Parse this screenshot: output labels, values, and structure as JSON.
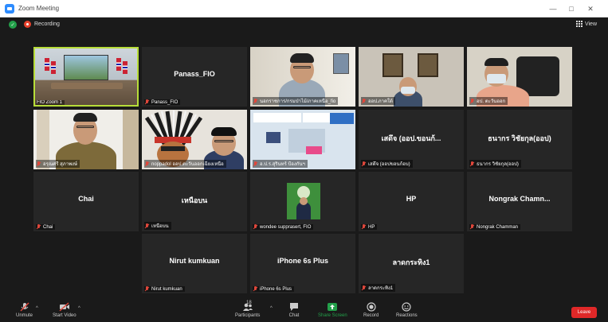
{
  "window": {
    "title": "Zoom Meeting"
  },
  "status": {
    "recording_label": "Recording",
    "view_label": "View"
  },
  "tiles": [
    {
      "id": "t1",
      "display_name": "",
      "label": "FIO Zoom 1",
      "video": true,
      "active": true
    },
    {
      "id": "t2",
      "display_name": "Panass_FIO",
      "label": "Panass_FIO",
      "video": false
    },
    {
      "id": "t3",
      "display_name": "",
      "label": "นอกราชการ/กรมป่าไม้/ภาคเหนือ_fio",
      "video": true
    },
    {
      "id": "t4",
      "display_name": "",
      "label": "ออป.ภาคใต้",
      "video": true
    },
    {
      "id": "t5",
      "display_name": "",
      "label": "อป. ตะวันออก",
      "video": true
    },
    {
      "id": "t6",
      "display_name": "",
      "label": "อรุณศรี สุภาพงษ์",
      "video": true
    },
    {
      "id": "t7",
      "display_name": "",
      "label": "noppadol ออป.ตะวันออกเฉียงเหนือ",
      "video": true
    },
    {
      "id": "t8",
      "display_name": "",
      "label": "อ.ป.ร.สุรินทร์ ป้องกันฯ",
      "video": true
    },
    {
      "id": "t9",
      "display_name": "เสดึจ (ออป.ขอนก้...",
      "label": "เสดึจ (ออปขอนก้อบ)",
      "video": false
    },
    {
      "id": "t10",
      "display_name": "ธนากร วิชัยกุล(ออป)",
      "label": "ธนากร วิชัยกุล(ออป)",
      "video": false
    },
    {
      "id": "t11",
      "display_name": "Chai",
      "label": "Chai",
      "video": false
    },
    {
      "id": "t12",
      "display_name": "เหนือบน",
      "label": "เหนือบน",
      "video": false
    },
    {
      "id": "t13",
      "display_name": "",
      "label": "wondee supprasert, FIO",
      "video": true
    },
    {
      "id": "t14",
      "display_name": "HP",
      "label": "HP",
      "video": false
    },
    {
      "id": "t15",
      "display_name": "Nongrak Chamn...",
      "label": "Nongrak Chamman",
      "video": false
    },
    {
      "id": "t16",
      "display_name": "Nirut kumkuan",
      "label": "Nirut kumkuan",
      "video": false
    },
    {
      "id": "t17",
      "display_name": "iPhone 6s Plus",
      "label": "iPhone 6s Plus",
      "video": false
    },
    {
      "id": "t18",
      "display_name": "ลาดกระทิง1",
      "label": "ลาดกระทิง1",
      "video": false
    }
  ],
  "toolbar": {
    "unmute": "Unmute",
    "start_video": "Start Video",
    "participants": "Participants",
    "participants_count": "18",
    "chat": "Chat",
    "share_screen": "Share Screen",
    "record": "Record",
    "reactions": "Reactions",
    "leave": "Leave"
  },
  "colors": {
    "active_speaker": "#b7dd39",
    "share_green": "#23a04a",
    "leave_red": "#e02828",
    "muted_red": "#e0473b"
  }
}
